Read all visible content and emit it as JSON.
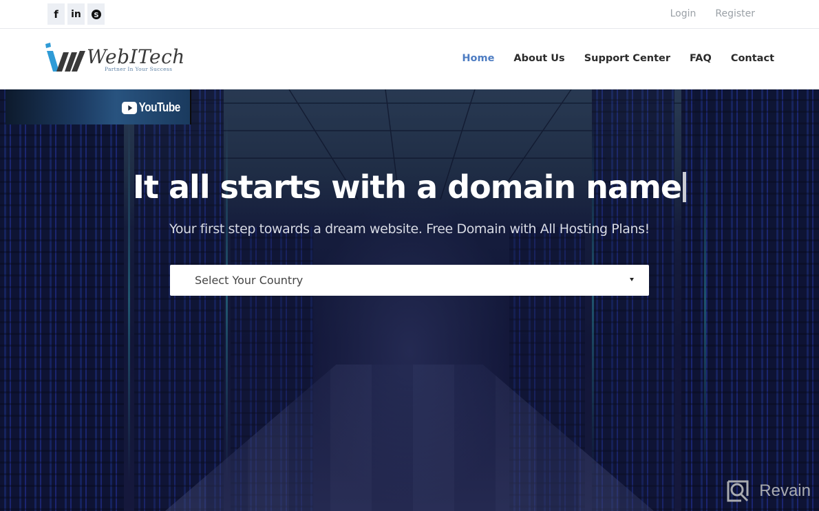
{
  "topbar": {
    "social": [
      {
        "name": "facebook",
        "icon": "facebook-icon",
        "glyph": "f"
      },
      {
        "name": "linkedin",
        "icon": "linkedin-icon",
        "glyph": "in"
      },
      {
        "name": "skype",
        "icon": "skype-icon",
        "glyph": "S"
      }
    ],
    "login_label": "Login",
    "register_label": "Register"
  },
  "brand": {
    "name": "WebITech",
    "tagline": "Partner In Your Success",
    "colors": {
      "mark_blue": "#2f9bd6",
      "mark_dark": "#3a3a3a",
      "tagline": "#5b7fa3"
    }
  },
  "nav": {
    "items": [
      {
        "label": "Home",
        "active": true
      },
      {
        "label": "About Us",
        "active": false
      },
      {
        "label": "Support Center",
        "active": false
      },
      {
        "label": "FAQ",
        "active": false
      },
      {
        "label": "Contact",
        "active": false
      }
    ],
    "active_color": "#4d7cc2"
  },
  "hero": {
    "youtube_label": "YouTube",
    "headline": "It all starts with a domain name",
    "subline": "Your first step towards a dream website. Free Domain with All Hosting Plans!",
    "country_select": {
      "selected": "Select Your Country"
    }
  },
  "watermark": {
    "label": "Revain"
  }
}
